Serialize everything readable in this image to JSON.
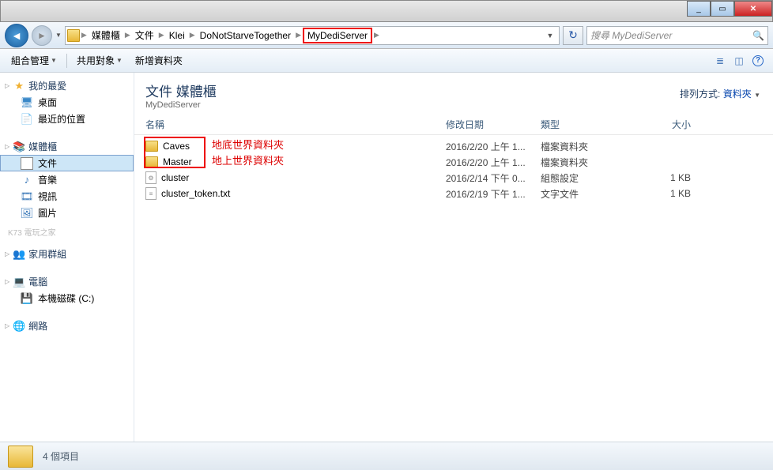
{
  "titlebar": {
    "min": "_",
    "max": "▭",
    "close": "✕"
  },
  "nav": {
    "breadcrumbs": [
      "媒體櫃",
      "文件",
      "Klei",
      "DoNotStarveTogether",
      "MyDediServer"
    ],
    "search_placeholder": "搜尋 MyDediServer"
  },
  "toolbar": {
    "organize": "組合管理",
    "share": "共用對象",
    "newfolder": "新增資料夾"
  },
  "sidebar": {
    "favorites": {
      "label": "我的最愛",
      "items": [
        "桌面",
        "最近的位置"
      ]
    },
    "libraries": {
      "label": "媒體櫃",
      "items": [
        "文件",
        "音樂",
        "視訊",
        "圖片"
      ]
    },
    "homegroup": {
      "label": "家用群組"
    },
    "computer": {
      "label": "電腦",
      "items": [
        "本機磁碟 (C:)"
      ]
    },
    "network": {
      "label": "網路"
    },
    "watermark": "K73 電玩之家"
  },
  "header": {
    "title": "文件 媒體櫃",
    "subtitle": "MyDediServer",
    "arrange_label": "排列方式:",
    "arrange_value": "資料夾"
  },
  "columns": {
    "name": "名稱",
    "date": "修改日期",
    "type": "類型",
    "size": "大小"
  },
  "files": [
    {
      "icon": "folder",
      "name": "Caves",
      "date": "2016/2/20 上午 1...",
      "type": "檔案資料夾",
      "size": ""
    },
    {
      "icon": "folder",
      "name": "Master",
      "date": "2016/2/20 上午 1...",
      "type": "檔案資料夾",
      "size": ""
    },
    {
      "icon": "cfg",
      "name": "cluster",
      "date": "2016/2/14 下午 0...",
      "type": "組態設定",
      "size": "1 KB"
    },
    {
      "icon": "txt",
      "name": "cluster_token.txt",
      "date": "2016/2/19 下午 1...",
      "type": "文字文件",
      "size": "1 KB"
    }
  ],
  "annotations": {
    "caves": "地底世界資料夾",
    "master": "地上世界資料夾"
  },
  "status": {
    "count": "4 個項目"
  }
}
